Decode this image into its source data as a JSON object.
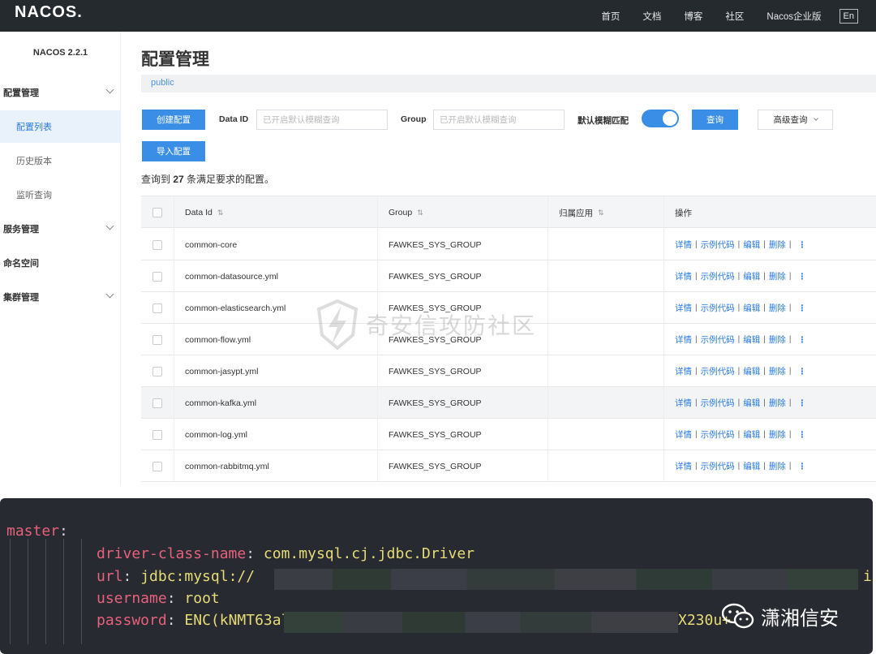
{
  "header": {
    "logo": "NACOS.",
    "nav": [
      "首页",
      "文档",
      "博客",
      "社区",
      "Nacos企业版"
    ],
    "lang": "En"
  },
  "sidebar": {
    "version": "NACOS 2.2.1",
    "items": [
      {
        "label": "配置管理",
        "type": "group"
      },
      {
        "label": "配置列表",
        "type": "sub",
        "active": true
      },
      {
        "label": "历史版本",
        "type": "sub"
      },
      {
        "label": "监听查询",
        "type": "sub"
      },
      {
        "label": "服务管理",
        "type": "group"
      },
      {
        "label": "命名空间",
        "type": "plain"
      },
      {
        "label": "集群管理",
        "type": "group"
      }
    ]
  },
  "main": {
    "title": "配置管理",
    "namespace": "public",
    "create_btn": "创建配置",
    "import_btn": "导入配置",
    "dataid_label": "Data ID",
    "dataid_placeholder": "已开启默认模糊查询",
    "group_label": "Group",
    "group_placeholder": "已开启默认模糊查询",
    "fuzzy_label": "默认模糊匹配",
    "query_btn": "查询",
    "advanced_btn": "高级查询",
    "result_prefix": "查询到 ",
    "result_count": "27",
    "result_suffix": " 条满足要求的配置。"
  },
  "table": {
    "headers": [
      "Data Id",
      "Group",
      "归属应用",
      "操作"
    ],
    "rows": [
      {
        "data_id": "common-core",
        "group": "FAWKES_SYS_GROUP"
      },
      {
        "data_id": "common-datasource.yml",
        "group": "FAWKES_SYS_GROUP"
      },
      {
        "data_id": "common-elasticsearch.yml",
        "group": "FAWKES_SYS_GROUP"
      },
      {
        "data_id": "common-flow.yml",
        "group": "FAWKES_SYS_GROUP"
      },
      {
        "data_id": "common-jasypt.yml",
        "group": "FAWKES_SYS_GROUP"
      },
      {
        "data_id": "common-kafka.yml",
        "group": "FAWKES_SYS_GROUP"
      },
      {
        "data_id": "common-log.yml",
        "group": "FAWKES_SYS_GROUP"
      },
      {
        "data_id": "common-rabbitmq.yml",
        "group": "FAWKES_SYS_GROUP"
      }
    ],
    "ops": [
      "详情",
      "示例代码",
      "编辑",
      "删除"
    ]
  },
  "watermark": "奇安信攻防社区",
  "code": {
    "master": "master",
    "driver_key": "driver-class-name",
    "driver_val": "com.mysql.cj.jdbc.Driver",
    "url_key": "url",
    "url_val": "jdbc:mysql://",
    "url_tail": "i",
    "user_key": "username",
    "user_val": "root",
    "pass_key": "password",
    "pass_val": "ENC(kNMT63al",
    "pass_tail": "X230u+"
  },
  "brand": "潇湘信安",
  "colors": {
    "accent": "#3b8ee6",
    "topbar": "#252a2f",
    "code_bg": "#282a32",
    "code_key": "#e6617b",
    "code_val": "#e6db74"
  }
}
